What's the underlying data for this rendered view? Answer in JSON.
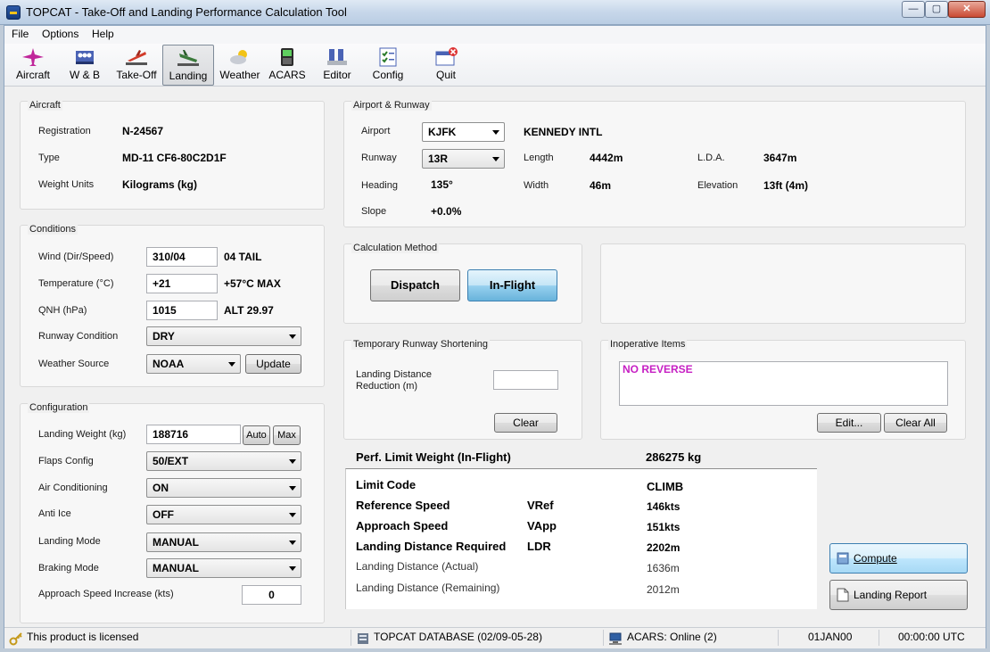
{
  "window": {
    "title": "TOPCAT - Take-Off and Landing Performance Calculation Tool"
  },
  "menu": [
    "File",
    "Options",
    "Help"
  ],
  "toolbar": [
    {
      "label": "Aircraft",
      "icon": "aircraft-icon"
    },
    {
      "label": "W & B",
      "icon": "weight-balance-icon"
    },
    {
      "label": "Take-Off",
      "icon": "takeoff-icon"
    },
    {
      "label": "Landing",
      "icon": "landing-icon",
      "active": true
    },
    {
      "label": "Weather",
      "icon": "weather-icon"
    },
    {
      "label": "ACARS",
      "icon": "acars-icon"
    },
    {
      "label": "Editor",
      "icon": "editor-icon"
    },
    {
      "label": "Config",
      "icon": "config-icon"
    },
    {
      "label": "Quit",
      "icon": "quit-icon"
    }
  ],
  "aircraft": {
    "title": "Aircraft",
    "registration_label": "Registration",
    "registration": "N-24567",
    "type_label": "Type",
    "type": "MD-11 CF6-80C2D1F",
    "units_label": "Weight Units",
    "units": "Kilograms (kg)"
  },
  "conditions": {
    "title": "Conditions",
    "wind_label": "Wind (Dir/Speed)",
    "wind": "310/04",
    "wind_info": "04 TAIL",
    "temp_label": "Temperature (°C)",
    "temp": "+21",
    "temp_info": "+57°C MAX",
    "qnh_label": "QNH (hPa)",
    "qnh": "1015",
    "qnh_info": "ALT 29.97",
    "rwycond_label": "Runway Condition",
    "rwycond": "DRY",
    "wxsource_label": "Weather Source",
    "wxsource": "NOAA",
    "update": "Update"
  },
  "configuration": {
    "title": "Configuration",
    "lw_label": "Landing Weight (kg)",
    "lw": "188716",
    "auto": "Auto",
    "max": "Max",
    "flaps_label": "Flaps Config",
    "flaps": "50/EXT",
    "ac_label": "Air Conditioning",
    "ac": "ON",
    "antiice_label": "Anti Ice",
    "antiice": "OFF",
    "lmode_label": "Landing Mode",
    "lmode": "MANUAL",
    "bmode_label": "Braking Mode",
    "bmode": "MANUAL",
    "asi_label": "Approach Speed Increase (kts)",
    "asi": "0"
  },
  "airport": {
    "title": "Airport & Runway",
    "airport_label": "Airport",
    "airport": "KJFK",
    "name": "KENNEDY INTL",
    "runway_label": "Runway",
    "runway": "13R",
    "length_label": "Length",
    "length": "4442m",
    "lda_label": "L.D.A.",
    "lda": "3647m",
    "heading_label": "Heading",
    "heading": "135°",
    "width_label": "Width",
    "width": "46m",
    "elev_label": "Elevation",
    "elev": "13ft (4m)",
    "slope_label": "Slope",
    "slope": "+0.0%"
  },
  "calc": {
    "title": "Calculation Method",
    "dispatch": "Dispatch",
    "inflight": "In-Flight"
  },
  "shortening": {
    "title": "Temporary Runway Shortening",
    "label": "Landing Distance Reduction (m)",
    "value": "",
    "clear": "Clear"
  },
  "inop": {
    "title": "Inoperative Items",
    "item": "NO REVERSE",
    "edit": "Edit...",
    "clearall": "Clear All"
  },
  "results": {
    "plw_label": "Perf. Limit Weight (In-Flight)",
    "plw": "286275 kg",
    "limit_label": "Limit Code",
    "limit": "CLIMB",
    "vref_label": "Reference Speed",
    "vref_abbr": "VRef",
    "vref": "146kts",
    "vapp_label": "Approach Speed",
    "vapp_abbr": "VApp",
    "vapp": "151kts",
    "ldr_label": "Landing Distance Required",
    "ldr_abbr": "LDR",
    "ldr": "2202m",
    "lda_actual_label": "Landing Distance (Actual)",
    "lda_actual": "1636m",
    "lda_remain_label": "Landing Distance (Remaining)",
    "lda_remain": "2012m"
  },
  "actions": {
    "compute": "Compute",
    "report": "Landing Report"
  },
  "status": {
    "license": "This product is licensed",
    "database": "TOPCAT DATABASE (02/09-05-28)",
    "acars": "ACARS: Online (2)",
    "date": "01JAN00",
    "time": "00:00:00 UTC"
  }
}
